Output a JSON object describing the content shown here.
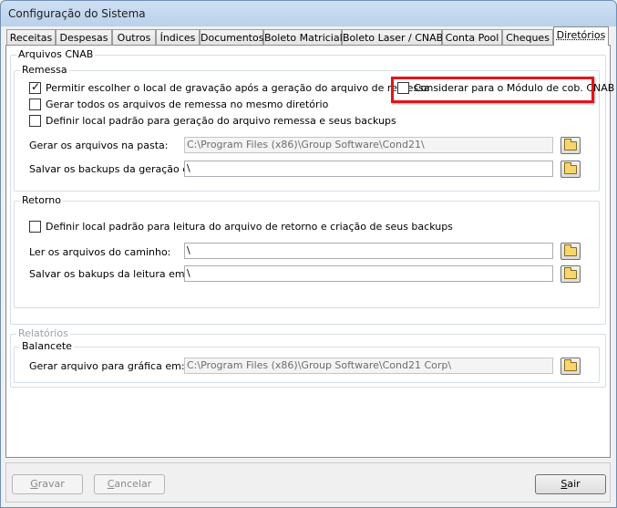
{
  "window": {
    "title": "Configuração do Sistema"
  },
  "tabs": [
    {
      "label": "Receitas"
    },
    {
      "label": "Despesas"
    },
    {
      "label": "Outros"
    },
    {
      "label": "Índices"
    },
    {
      "label": "Documentos"
    },
    {
      "label": "Boleto Matricial"
    },
    {
      "label": "Boleto Laser / CNAB"
    },
    {
      "label": "Conta Pool"
    },
    {
      "label": "Cheques"
    },
    {
      "label": "Diretórios",
      "active": true
    }
  ],
  "arquivos_cnab": {
    "title": "Arquivos CNAB",
    "remessa": {
      "title": "Remessa",
      "check_permitir": {
        "label": "Permitir escolher o local de gravação após a geração do arquivo de remessa",
        "checked": true
      },
      "check_considerar": {
        "label": "Considerar para o Módulo de cob. CNAB",
        "checked": false
      },
      "check_gerar_todos": {
        "label": "Gerar todos os arquivos de remessa no mesmo diretório",
        "checked": false
      },
      "check_definir": {
        "label": "Definir local padrão para geração do arquivo remessa e seus backups",
        "checked": false
      },
      "pasta_label": "Gerar os arquivos na pasta:",
      "pasta_value": "C:\\Program Files (x86)\\Group Software\\Cond21\\",
      "backup_label": "Salvar os backups da geração em:",
      "backup_value": "\\"
    },
    "retorno": {
      "title": "Retorno",
      "check_definir": {
        "label": "Definir local padrão para leitura do arquivo de retorno e criação de seus backups",
        "checked": false
      },
      "ler_label": "Ler os arquivos do caminho:",
      "ler_value": "\\",
      "bakups_label": "Salvar os bakups da leitura em:",
      "bakups_value": "\\"
    }
  },
  "relatorios": {
    "title": "Relatórios",
    "balancete": {
      "title": "Balancete",
      "grafica_label": "Gerar arquivo para gráfica em:",
      "grafica_value": "C:\\Program Files (x86)\\Group Software\\Cond21 Corp\\"
    }
  },
  "buttons": {
    "gravar": {
      "first": "G",
      "rest": "ravar"
    },
    "cancelar": {
      "first": "C",
      "rest": "ancelar"
    },
    "sair": {
      "first": "S",
      "rest": "air"
    }
  },
  "colors": {
    "highlight": "#e2141c",
    "titlebar": "#b9d1ea"
  },
  "icons": {
    "folder": "folder-icon",
    "check": "checkmark-icon"
  }
}
